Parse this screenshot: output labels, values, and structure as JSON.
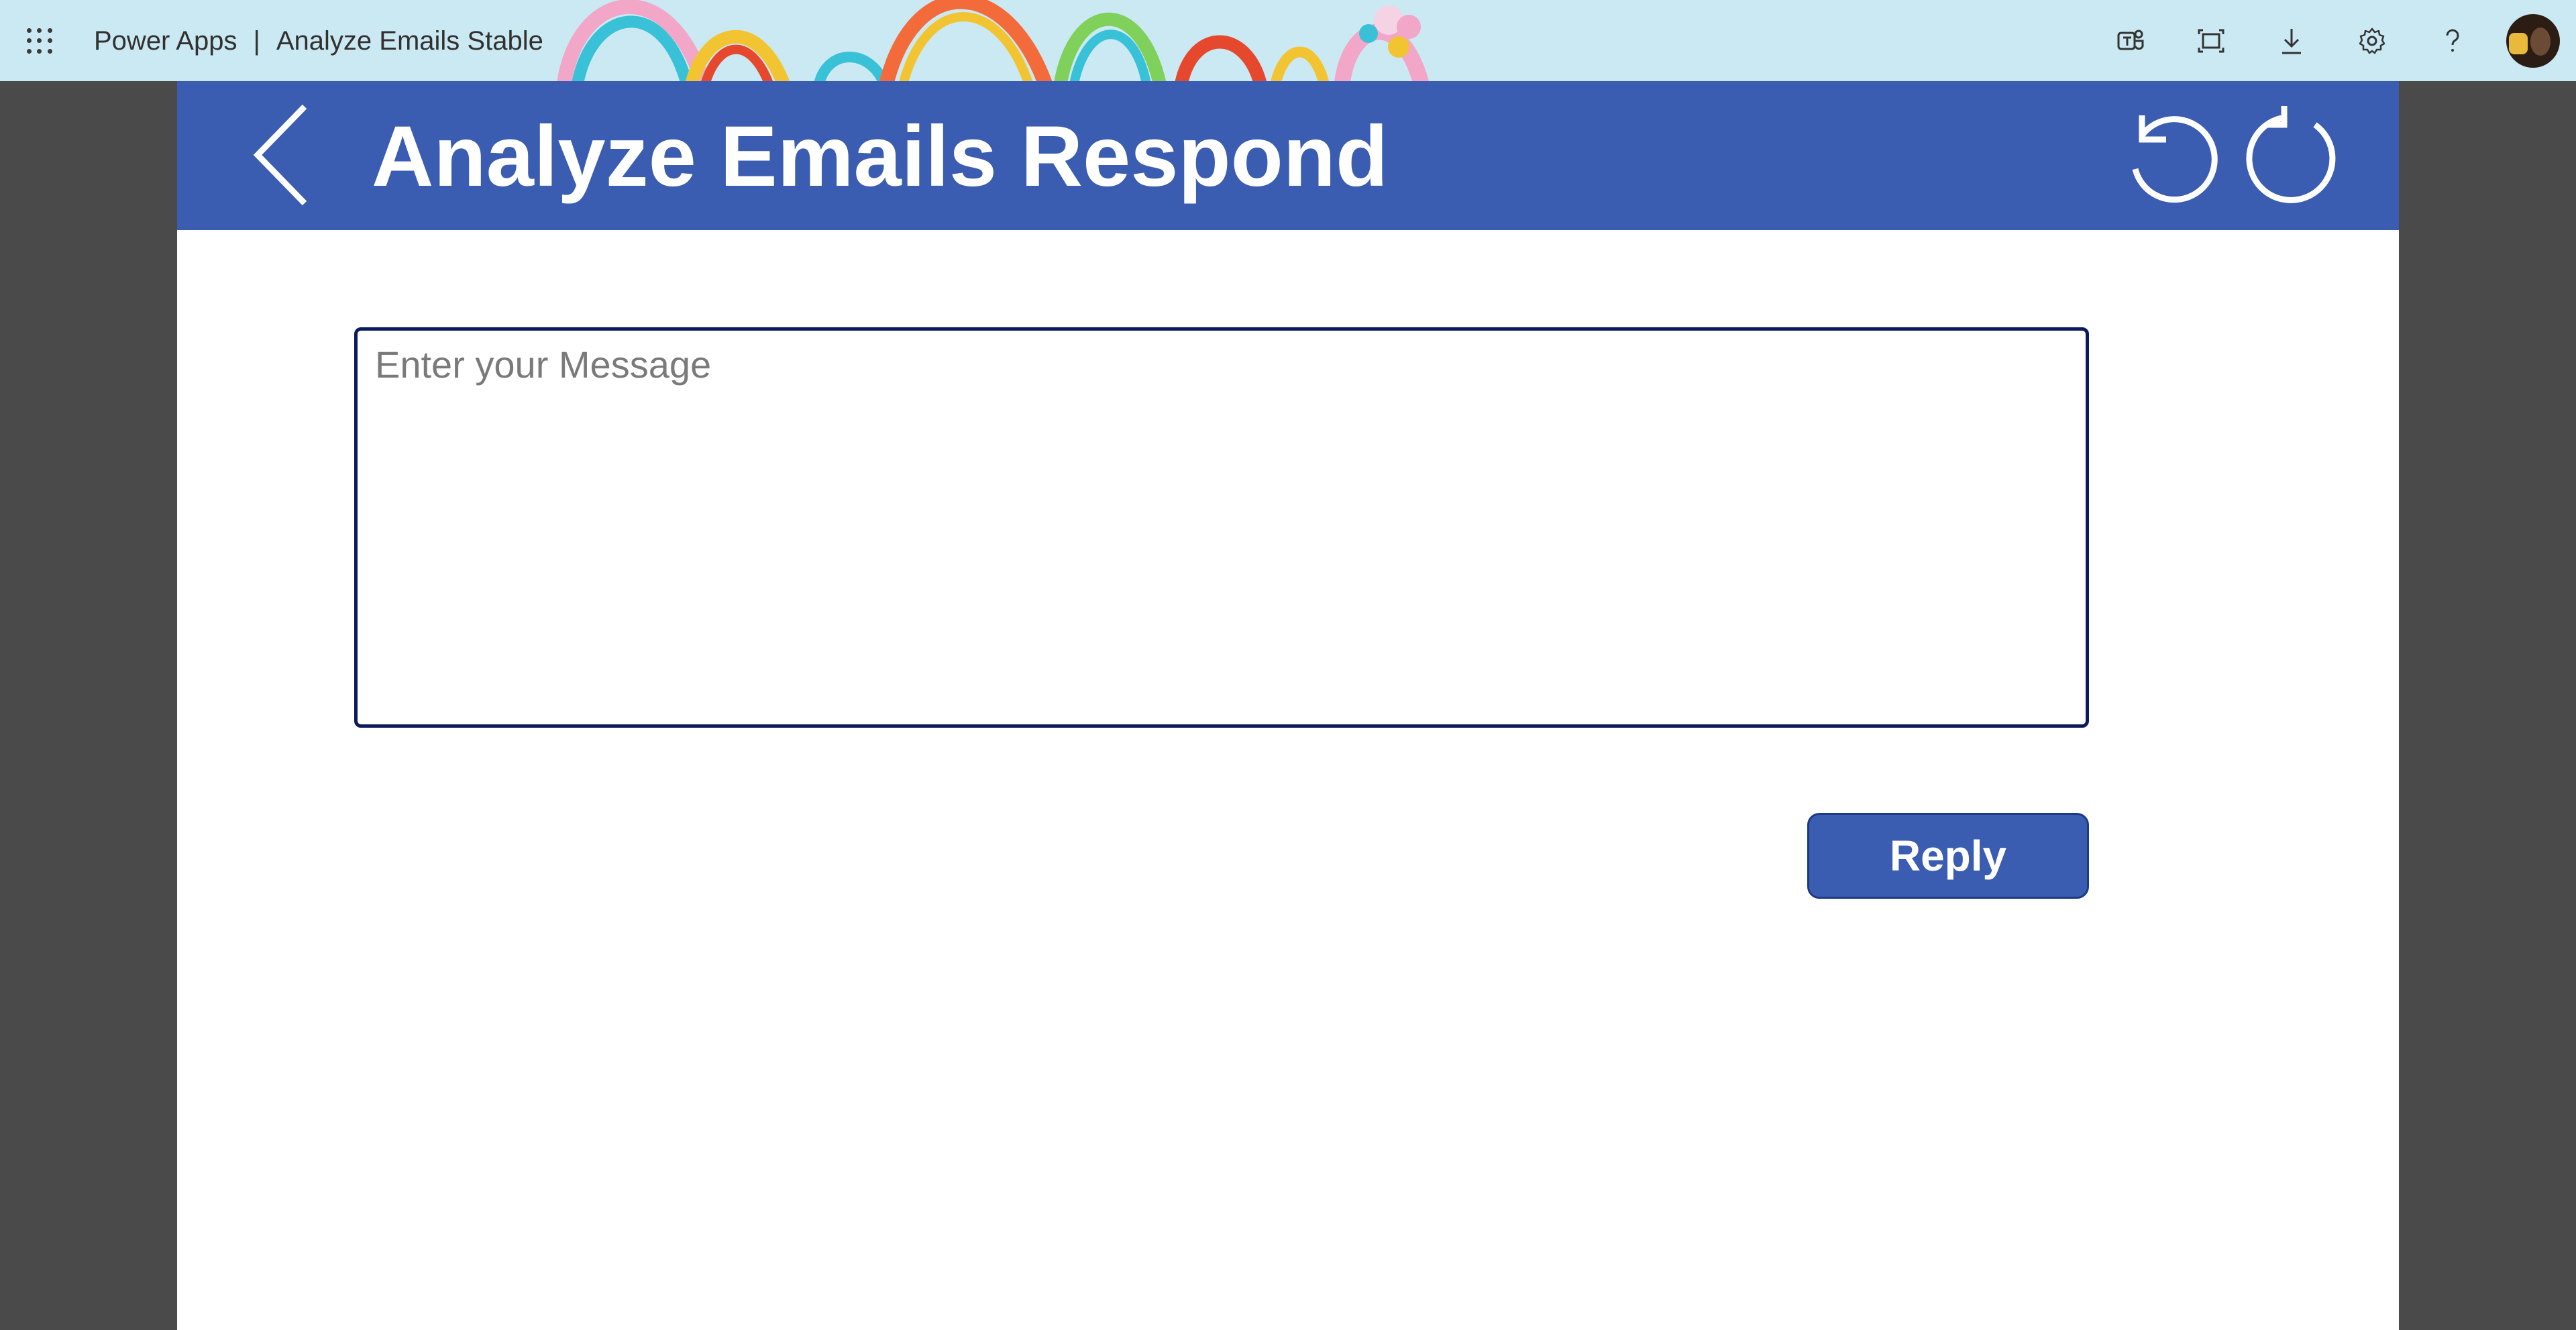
{
  "suite": {
    "product": "Power Apps",
    "separator": "|",
    "app_name": "Analyze Emails Stable",
    "icons": [
      "app-launcher-icon",
      "teams-icon",
      "fit-to-screen-icon",
      "download-icon",
      "settings-icon",
      "help-icon"
    ]
  },
  "header": {
    "title": "Analyze Emails Respond",
    "icons": [
      "back-arrow-icon",
      "undo-icon",
      "refresh-icon"
    ],
    "background": "#3a5db1"
  },
  "form": {
    "message_placeholder": "Enter your Message",
    "message_value": "",
    "reply_label": "Reply"
  },
  "colors": {
    "accent": "#3a5db1",
    "input_border": "#0b1a5c",
    "suitebar": "#cbe9f3",
    "backdrop": "#4a4a4a"
  }
}
